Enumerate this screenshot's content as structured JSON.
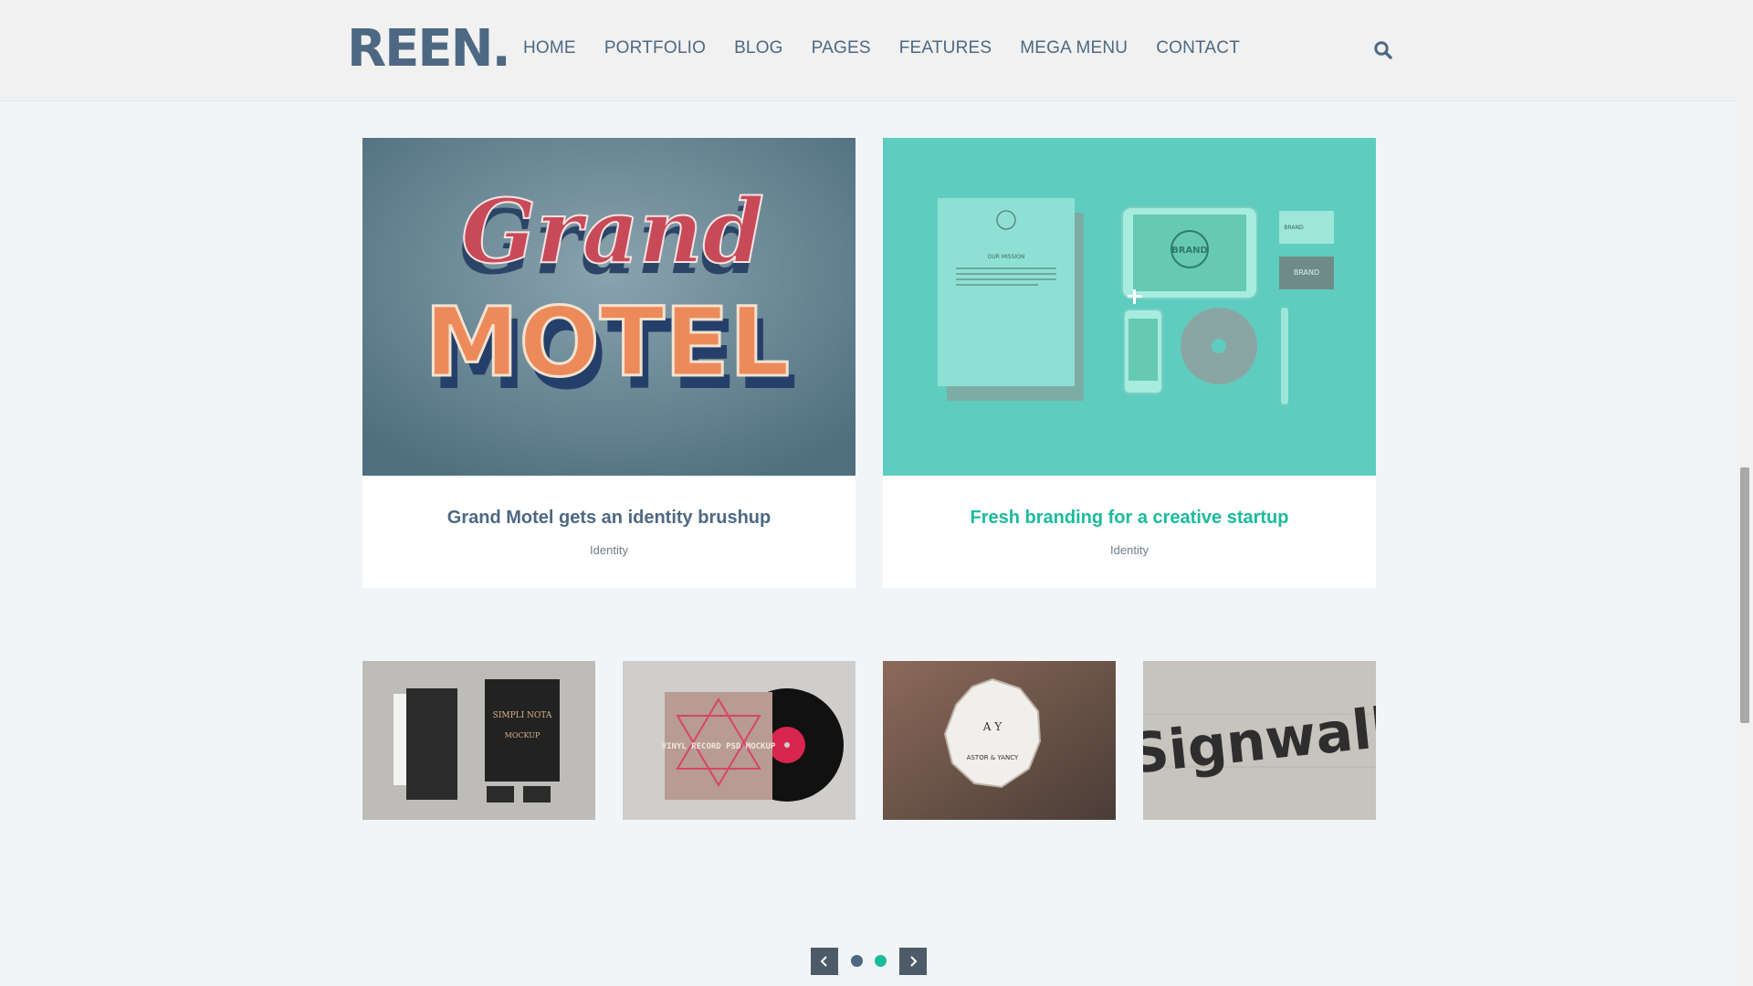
{
  "header": {
    "logo": "REEN.",
    "nav": [
      "HOME",
      "PORTFOLIO",
      "BLOG",
      "PAGES",
      "FEATURES",
      "MEGA MENU",
      "CONTACT"
    ]
  },
  "featured": [
    {
      "title": "Grand Motel gets an identity brushup",
      "category": "Identity",
      "art_line1": "Grand",
      "art_line2": "MOTEL"
    },
    {
      "title": "Fresh branding for a creative startup",
      "category": "Identity",
      "art_text": "BRAND",
      "art_sub": "OUR MISSION"
    }
  ],
  "thumbnails": [
    {
      "art_text": "SIMPLI NOTA",
      "art_sub": "MOCKUP"
    },
    {
      "art_text": "VINYL RECORD PSD MOCKUP"
    },
    {
      "art_text": "A  Y",
      "art_sub": "ASTOR & YANCY"
    },
    {
      "art_text": "Signwall"
    }
  ],
  "colors": {
    "primary": "#4d6883",
    "accent": "#1abb9c",
    "background": "#f2f5f7",
    "pager_button": "#4d5b69"
  },
  "icons": {
    "search": "search-icon",
    "prev": "chevron-left-icon",
    "next": "chevron-right-icon"
  },
  "pager": {
    "active_index": 1
  }
}
